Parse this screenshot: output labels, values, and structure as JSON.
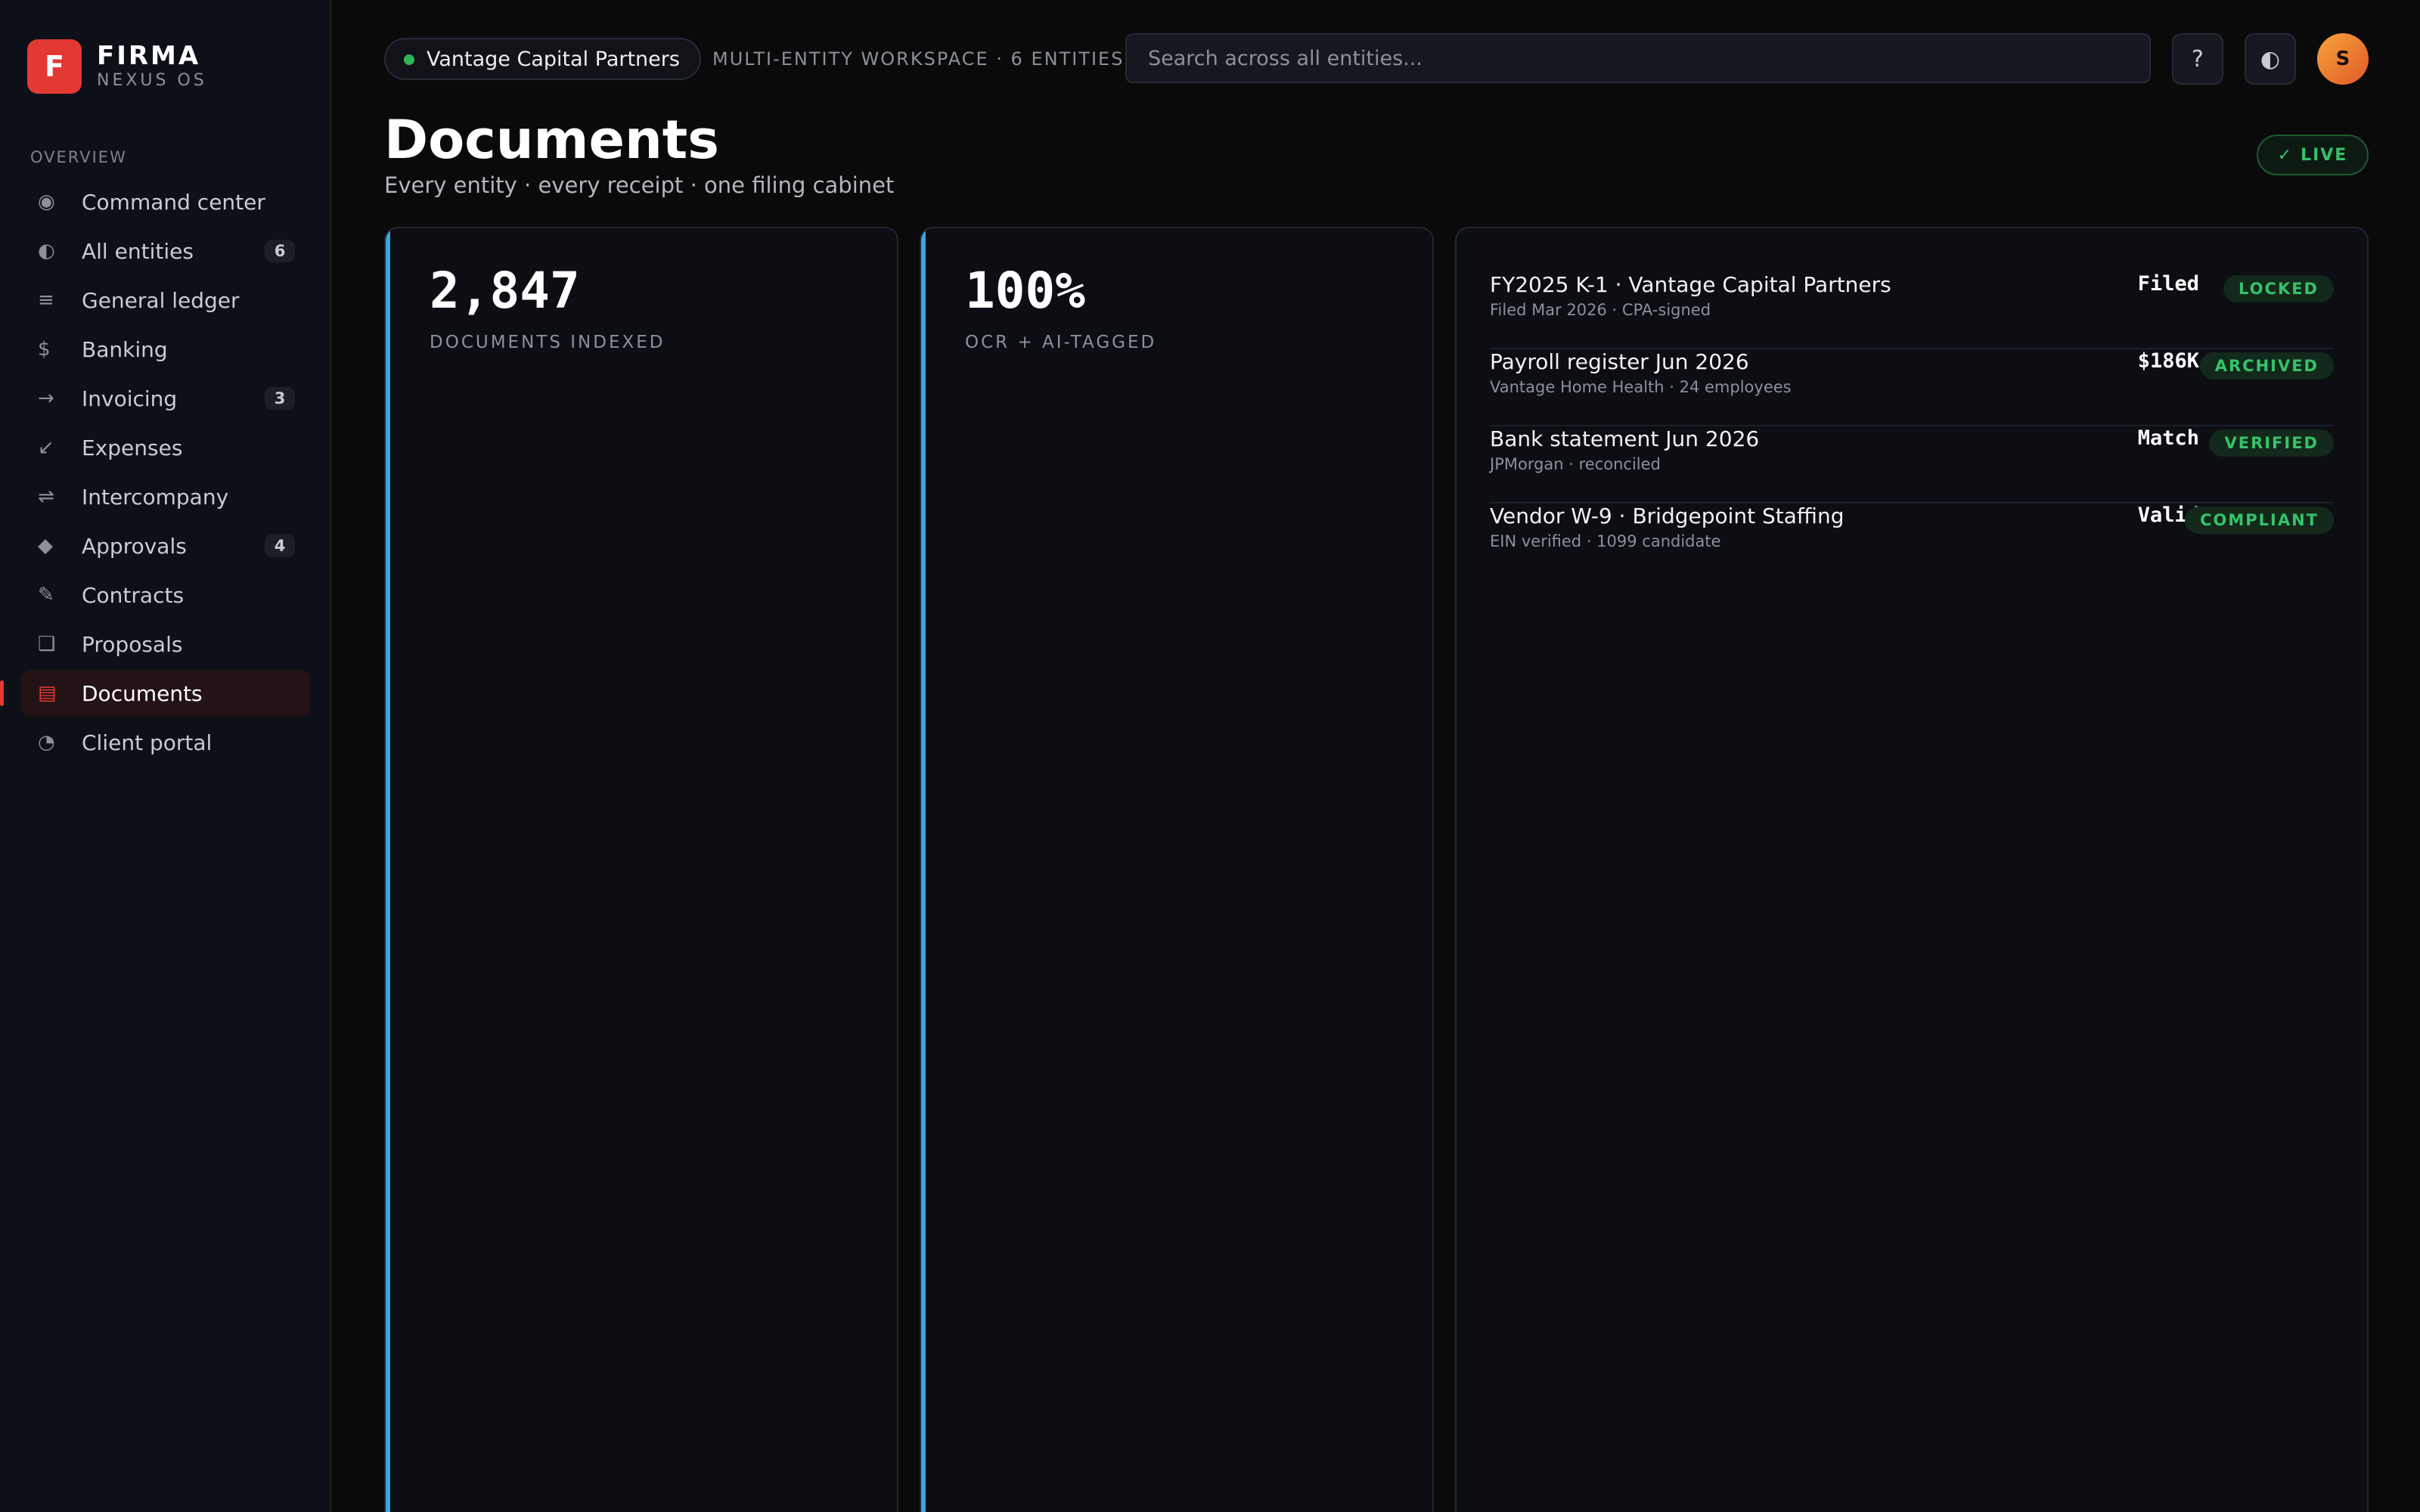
{
  "brand": {
    "logo_letter": "F",
    "name": "FIRMA",
    "subtitle": "NEXUS OS"
  },
  "sidebar": {
    "section_label": "OVERVIEW",
    "items": [
      {
        "label": "Command center",
        "icon": "◉",
        "icon_name": "target-icon"
      },
      {
        "label": "All entities",
        "icon": "◐",
        "icon_name": "half-circle-icon",
        "badge": "6"
      },
      {
        "label": "General ledger",
        "icon": "≡",
        "icon_name": "ledger-icon"
      },
      {
        "label": "Banking",
        "icon": "$",
        "icon_name": "dollar-icon"
      },
      {
        "label": "Invoicing",
        "icon": "→",
        "icon_name": "arrow-right-icon",
        "badge": "3"
      },
      {
        "label": "Expenses",
        "icon": "↙",
        "icon_name": "arrow-down-left-icon"
      },
      {
        "label": "Intercompany",
        "icon": "⇌",
        "icon_name": "exchange-icon"
      },
      {
        "label": "Approvals",
        "icon": "◆",
        "icon_name": "diamond-icon",
        "badge": "4"
      },
      {
        "label": "Contracts",
        "icon": "✎",
        "icon_name": "pen-icon"
      },
      {
        "label": "Proposals",
        "icon": "❑",
        "icon_name": "square-icon"
      },
      {
        "label": "Documents",
        "icon": "▤",
        "icon_name": "document-icon",
        "active": true
      },
      {
        "label": "Client portal",
        "icon": "◔",
        "icon_name": "portal-icon"
      }
    ]
  },
  "topbar": {
    "entity": "Vantage Capital Partners",
    "workspace": "MULTI-ENTITY WORKSPACE · 6 ENTITIES",
    "search_placeholder": "Search across all entities...",
    "help_label": "?",
    "theme_label": "◐",
    "avatar_initial": "S"
  },
  "header": {
    "title": "Documents",
    "subtitle": "Every entity · every receipt · one filing cabinet",
    "live_check": "✓",
    "live_label": "LIVE"
  },
  "stats": [
    {
      "value": "2,847",
      "label": "DOCUMENTS INDEXED"
    },
    {
      "value": "100%",
      "label": "OCR + AI-TAGGED"
    }
  ],
  "documents": [
    {
      "title": "FY2025 K-1 · Vantage Capital Partners",
      "meta": "Filed Mar 2026 · CPA-signed",
      "value": "Filed",
      "status": "LOCKED"
    },
    {
      "title": "Payroll register Jun 2026",
      "meta": "Vantage Home Health · 24 employees",
      "value": "$186K",
      "status": "ARCHIVED"
    },
    {
      "title": "Bank statement Jun 2026",
      "meta": "JPMorgan · reconciled",
      "value": "Match",
      "status": "VERIFIED"
    },
    {
      "title": "Vendor W-9 · Bridgepoint Staffing",
      "meta": "EIN verified · 1099 candidate",
      "value": "Valid",
      "status": "COMPLIANT"
    }
  ],
  "colors": {
    "accent": "#e23a33",
    "stat_accent": "#3aa6dc",
    "success": "#36c26a",
    "background": "#0a0a0b"
  }
}
